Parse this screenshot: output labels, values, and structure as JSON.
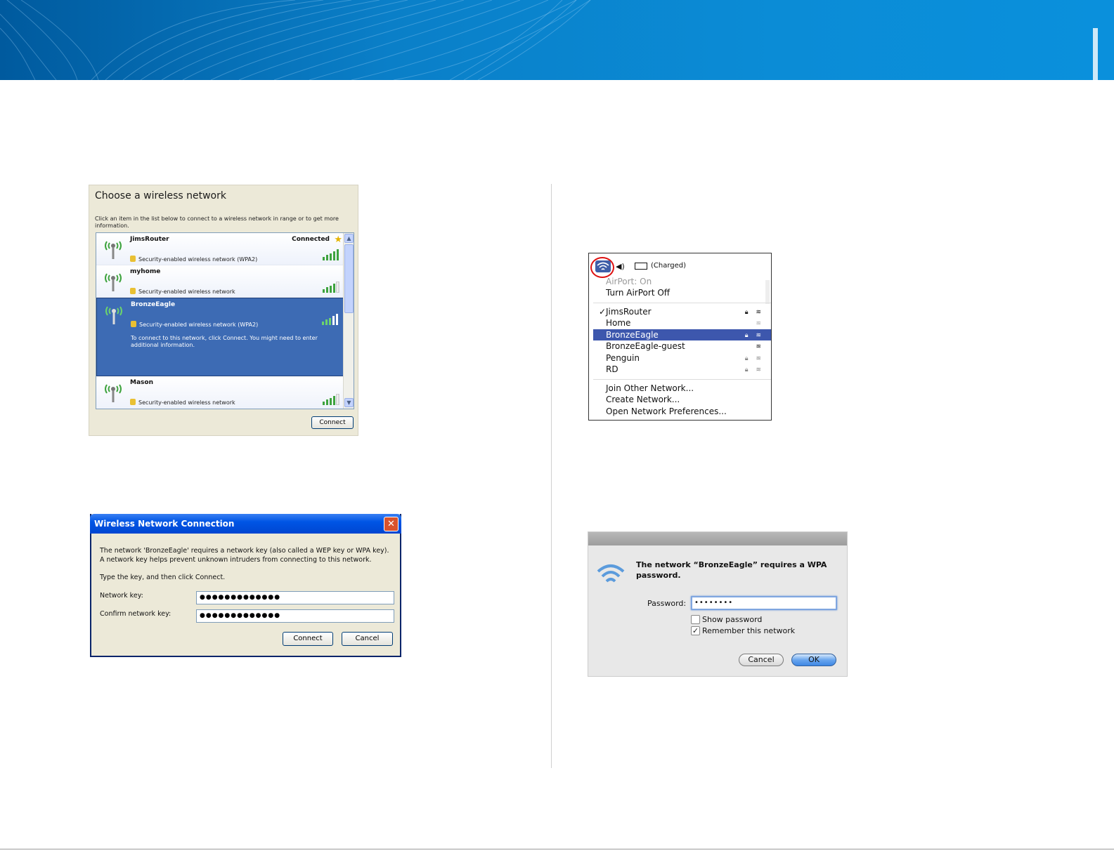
{
  "xp_choose": {
    "title": "Choose a wireless network",
    "description": "Click an item in the list below to connect to a wireless network in range or to get more information.",
    "networks": [
      {
        "name": "JimsRouter",
        "status": "Connected",
        "security": "Security-enabled wireless network (WPA2)",
        "signal": 5
      },
      {
        "name": "myhome",
        "status": "",
        "security": "Security-enabled wireless network",
        "signal": 4
      },
      {
        "name": "BronzeEagle",
        "status": "",
        "security": "Security-enabled wireless network (WPA2)",
        "signal": 3,
        "info": "To connect to this network, click Connect. You might need to enter additional information."
      },
      {
        "name": "Mason",
        "status": "",
        "security": "Security-enabled wireless network",
        "signal": 4
      }
    ],
    "connect_label": "Connect"
  },
  "xp_dialog": {
    "title": "Wireless Network Connection",
    "message": "The network 'BronzeEagle' requires a network key (also called a WEP key or WPA key). A network key helps prevent unknown intruders from connecting to this network.",
    "instruction": "Type the key, and then click Connect.",
    "network_key_label": "Network key:",
    "network_key_value": "●●●●●●●●●●●●●",
    "confirm_key_label": "Confirm network key:",
    "confirm_key_value": "●●●●●●●●●●●●●",
    "connect_label": "Connect",
    "cancel_label": "Cancel"
  },
  "mac_menu": {
    "battery_text": "(Charged)",
    "airport_status": "AirPort: On",
    "toggle_label": "Turn AirPort Off",
    "networks": [
      {
        "name": "JimsRouter",
        "checked": true,
        "locked": true
      },
      {
        "name": "Home",
        "checked": false,
        "locked": false
      },
      {
        "name": "BronzeEagle",
        "checked": false,
        "locked": true,
        "highlighted": true
      },
      {
        "name": "BronzeEagle-guest",
        "checked": false,
        "locked": false
      },
      {
        "name": "Penguin",
        "checked": false,
        "locked": true
      },
      {
        "name": "RD",
        "checked": false,
        "locked": true
      }
    ],
    "join_other": "Join Other Network...",
    "create_network": "Create Network...",
    "open_prefs": "Open Network Preferences..."
  },
  "mac_password": {
    "message": "The network “BronzeEagle” requires a WPA password.",
    "password_label": "Password:",
    "password_value": "••••••••",
    "show_password": "Show password",
    "show_password_checked": false,
    "remember_network": "Remember this network",
    "remember_checked": true,
    "cancel_label": "Cancel",
    "ok_label": "OK"
  },
  "colors": {
    "banner": "#0a7fc8",
    "xp_selection": "#3d6bb4",
    "mac_highlight": "#3d57ad",
    "xp_titlebar": "#0055e5"
  }
}
